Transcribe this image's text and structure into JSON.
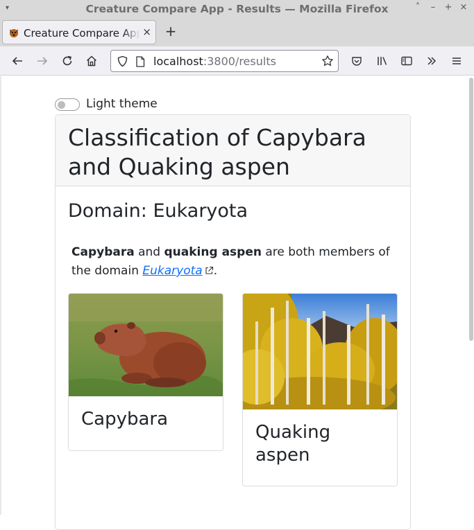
{
  "window": {
    "title": "Creature Compare App - Results — Mozilla Firefox"
  },
  "tabs": [
    {
      "label": "Creature Compare App - Results"
    }
  ],
  "navbar": {
    "url_host": "localhost",
    "url_rest": ":3800/results"
  },
  "theme_toggle": {
    "label": "Light theme",
    "checked": false
  },
  "header": {
    "title": "Classification of Capybara and Quaking aspen"
  },
  "domain": {
    "heading": "Domain: Eukaryota",
    "desc_name1": "Capybara",
    "desc_and": " and ",
    "desc_name2": "quaking aspen",
    "desc_mid": " are both members of the domain ",
    "desc_link": "Eukaryota",
    "desc_end": "."
  },
  "creatures": [
    {
      "name": "Capybara",
      "image": "capybara-photo"
    },
    {
      "name": "Quaking aspen",
      "image": "quaking-aspen-photo"
    }
  ],
  "colors": {
    "link": "#0d6efd",
    "text": "#212529",
    "header_bg": "#f7f7f7"
  }
}
